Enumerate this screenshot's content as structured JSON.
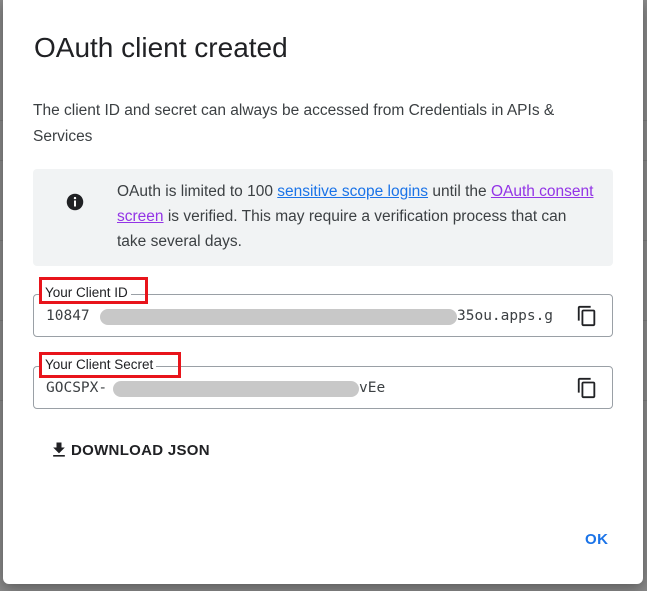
{
  "dialog": {
    "title": "OAuth client created",
    "intro": "The client ID and secret can always be accessed from Credentials in APIs & Services",
    "notice": {
      "icon": "info-icon",
      "text_1": "OAuth is limited to 100 ",
      "link_1": "sensitive scope logins",
      "text_2": " until the ",
      "link_2": "OAuth consent screen",
      "text_3": " is verified. This may require a verification process that can take several days."
    },
    "client_id": {
      "label": "Your Client ID",
      "value_start": "10847",
      "value_end": "35ou.apps.g",
      "copy_icon": "copy-icon"
    },
    "client_secret": {
      "label": "Your Client Secret",
      "value_start": "GOCSPX-",
      "value_end": "vEe",
      "copy_icon": "copy-icon"
    },
    "download_label": "DOWNLOAD JSON",
    "ok_label": "OK"
  },
  "colors": {
    "link": "#1a73e8",
    "visited_link": "#9334e6",
    "annotation_box": "#e8141b",
    "notice_bg": "#f1f3f4"
  }
}
